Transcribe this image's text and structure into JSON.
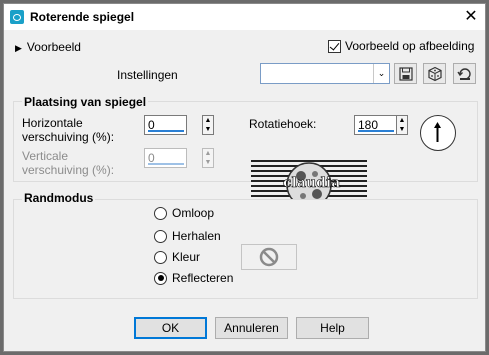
{
  "window": {
    "title": "Roterende spiegel",
    "close_glyph": "✕"
  },
  "preview": {
    "toggle_label": "Voorbeeld",
    "checkbox_label": "Voorbeeld op afbeelding",
    "checked": true
  },
  "settings": {
    "label": "Instellingen",
    "combo_value": ""
  },
  "mirror_group": {
    "title": "Plaatsing van spiegel",
    "horizontal_label_1": "Horizontale",
    "horizontal_label_2": "verschuiving (%):",
    "horizontal_value": "0",
    "vertical_label_1": "Verticale",
    "vertical_label_2": "verschuiving (%):",
    "vertical_value": "0",
    "rotation_label": "Rotatiehoek:",
    "rotation_value": "180",
    "watermark_text": "claudia"
  },
  "edge_group": {
    "title": "Randmodus",
    "options": [
      "Omloop",
      "Herhalen",
      "Kleur",
      "Reflecteren"
    ],
    "selected": "Reflecteren"
  },
  "buttons": {
    "ok": "OK",
    "cancel": "Annuleren",
    "help": "Help"
  },
  "colors": {
    "accent": "#0078d7",
    "spin_bar": "#2a7fd4",
    "app_icon": "#1aa0c8"
  }
}
